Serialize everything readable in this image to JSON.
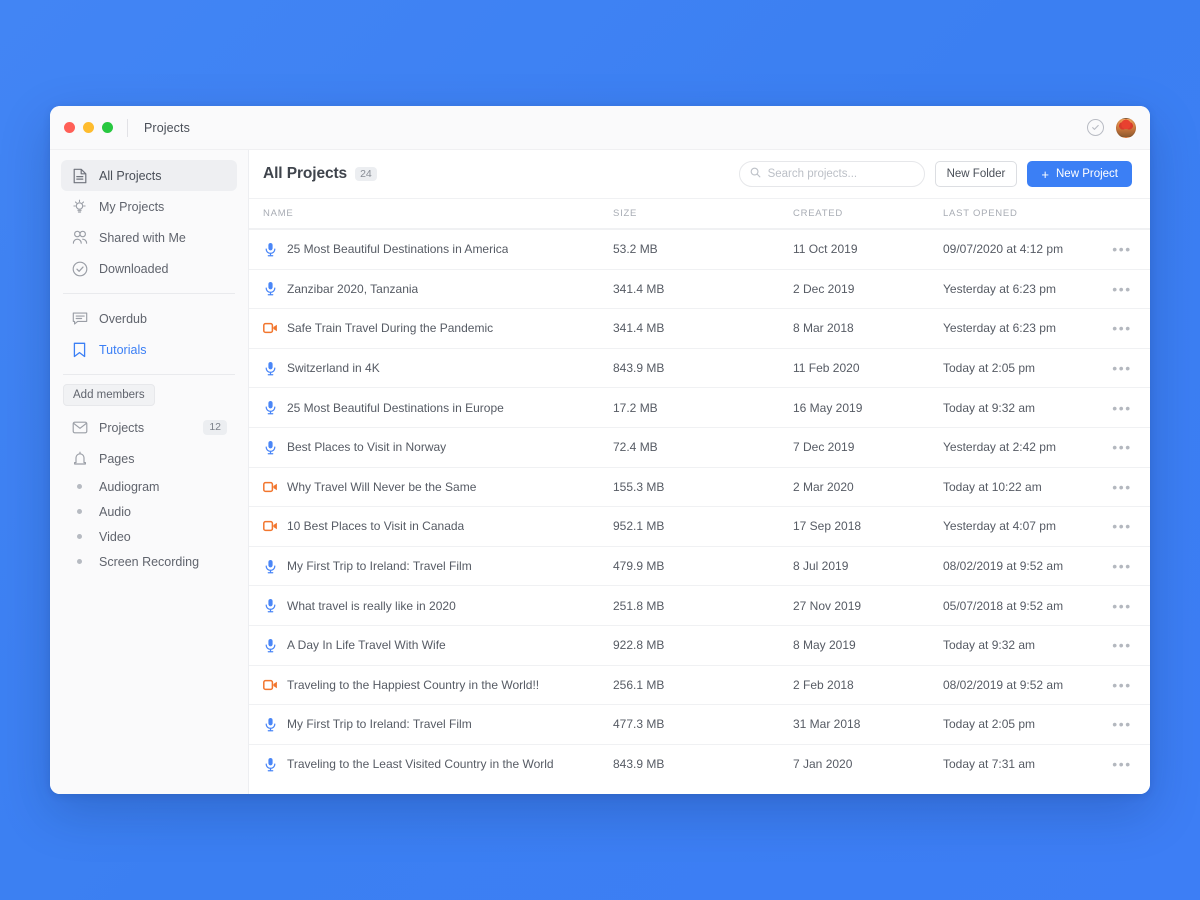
{
  "window": {
    "title": "Projects",
    "traffic_lights": [
      "close",
      "minimize",
      "maximize"
    ]
  },
  "titlebar_right": {
    "check_icon": "check-circle-icon",
    "avatar": "user-avatar"
  },
  "sidebar": {
    "primary_items": [
      {
        "label": "All Projects",
        "icon": "document-icon",
        "active": true
      },
      {
        "label": "My Projects",
        "icon": "lightbulb-icon",
        "active": false
      },
      {
        "label": "Shared with Me",
        "icon": "people-icon",
        "active": false
      },
      {
        "label": "Downloaded",
        "icon": "check-circle-icon",
        "active": false
      }
    ],
    "secondary_items": [
      {
        "label": "Overdub",
        "icon": "speech-bubble-icon",
        "accent": false
      },
      {
        "label": "Tutorials",
        "icon": "bookmark-icon",
        "accent": true
      }
    ],
    "add_members_label": "Add members",
    "tertiary_items": [
      {
        "label": "Projects",
        "icon": "envelope-icon",
        "badge": "12"
      },
      {
        "label": "Pages",
        "icon": "bell-icon",
        "badge": ""
      }
    ],
    "bullet_items": [
      {
        "label": "Audiogram"
      },
      {
        "label": "Audio"
      },
      {
        "label": "Video"
      },
      {
        "label": "Screen Recording"
      }
    ]
  },
  "toolbar": {
    "page_title": "All Projects",
    "count_badge": "24",
    "search_placeholder": "Search projects...",
    "search_value": "",
    "search_icon": "search-icon",
    "new_folder_label": "New Folder",
    "new_project_label": "New Project",
    "new_project_plus": "+"
  },
  "table": {
    "columns": [
      "NAME",
      "SIZE",
      "CREATED",
      "LAST OPENED"
    ],
    "rows": [
      {
        "icon": "microphone-icon",
        "name": "25 Most Beautiful Destinations in America",
        "size": "53.2 MB",
        "created": "11 Oct 2019",
        "opened": "09/07/2020 at 4:12 pm"
      },
      {
        "icon": "microphone-icon",
        "name": "Zanzibar 2020, Tanzania",
        "size": "341.4 MB",
        "created": "2 Dec 2019",
        "opened": "Yesterday at 6:23 pm"
      },
      {
        "icon": "video-icon",
        "name": "Safe Train Travel During the Pandemic",
        "size": "341.4 MB",
        "created": "8 Mar 2018",
        "opened": "Yesterday at 6:23 pm"
      },
      {
        "icon": "microphone-icon",
        "name": "Switzerland in 4K",
        "size": "843.9 MB",
        "created": "11 Feb 2020",
        "opened": "Today at 2:05 pm"
      },
      {
        "icon": "microphone-icon",
        "name": "25 Most Beautiful Destinations in Europe",
        "size": "17.2 MB",
        "created": "16 May 2019",
        "opened": "Today at 9:32 am"
      },
      {
        "icon": "microphone-icon",
        "name": "Best Places to Visit in Norway",
        "size": "72.4 MB",
        "created": "7 Dec 2019",
        "opened": "Yesterday at 2:42 pm"
      },
      {
        "icon": "video-icon",
        "name": "Why Travel Will Never be the Same",
        "size": "155.3 MB",
        "created": "2 Mar 2020",
        "opened": "Today at 10:22 am"
      },
      {
        "icon": "video-icon",
        "name": "10 Best Places to Visit in Canada",
        "size": "952.1 MB",
        "created": "17 Sep 2018",
        "opened": "Yesterday at 4:07 pm"
      },
      {
        "icon": "microphone-icon",
        "name": "My First Trip to Ireland: Travel Film",
        "size": "479.9 MB",
        "created": "8 Jul 2019",
        "opened": "08/02/2019 at 9:52 am"
      },
      {
        "icon": "microphone-icon",
        "name": "What travel is really like in 2020",
        "size": "251.8 MB",
        "created": "27 Nov 2019",
        "opened": "05/07/2018 at 9:52 am"
      },
      {
        "icon": "microphone-icon",
        "name": "A Day In Life Travel With Wife",
        "size": "922.8 MB",
        "created": "8 May 2019",
        "opened": "Today at 9:32 am"
      },
      {
        "icon": "video-icon",
        "name": "Traveling to the Happiest Country in the World!!",
        "size": "256.1 MB",
        "created": "2 Feb 2018",
        "opened": "08/02/2019 at 9:52 am"
      },
      {
        "icon": "microphone-icon",
        "name": "My First Trip to Ireland: Travel Film",
        "size": "477.3 MB",
        "created": "31 Mar 2018",
        "opened": "Today at 2:05 pm"
      },
      {
        "icon": "microphone-icon",
        "name": "Traveling to the Least Visited Country in the World",
        "size": "843.9 MB",
        "created": "7 Jan 2020",
        "opened": "Today at 7:31 am"
      }
    ],
    "row_menu_glyph": "•••"
  },
  "colors": {
    "desktop_background": "#3b7ff5",
    "accent": "#3b7ff5",
    "microphone_icon": "#4a86f7",
    "video_icon": "#f2762e",
    "sidebar_background": "#fafafb"
  }
}
